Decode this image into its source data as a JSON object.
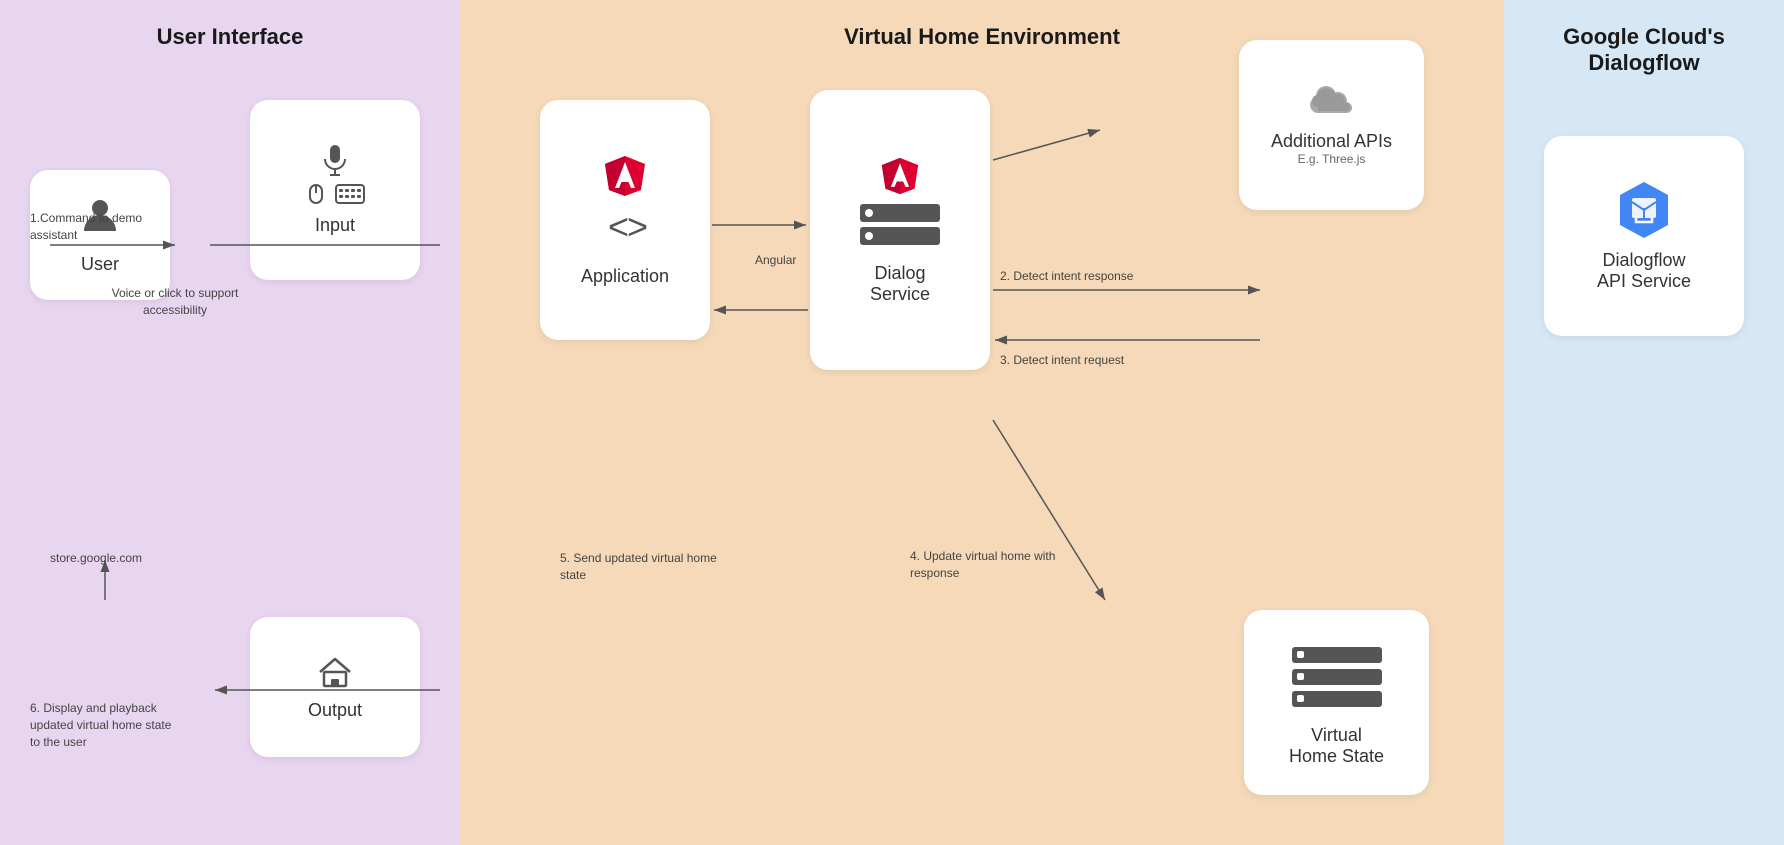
{
  "sections": {
    "user_interface": {
      "title": "User Interface",
      "user_card": {
        "label": "User"
      },
      "input_card": {
        "label": "Input"
      },
      "output_card": {
        "label": "Output"
      },
      "annotations": {
        "command": "1.Command to demo assistant",
        "voice": "Voice or click to support accessibility",
        "store": "store.google.com",
        "display": "6. Display and playback updated virtual home state to the user"
      }
    },
    "virtual_home": {
      "title": "Virtual Home Environment",
      "application_card": {
        "label": "Application"
      },
      "dialog_service_card": {
        "label": "Dialog\nService"
      },
      "additional_apis_card": {
        "label": "Additional APIs",
        "sublabel": "E.g. Three.js"
      },
      "virtual_home_state_card": {
        "label": "Virtual\nHome State"
      },
      "annotations": {
        "angular": "Angular",
        "step2": "2. Detect intent response",
        "step3": "3. Detect intent request",
        "step4": "4. Update virtual home\nwith response",
        "step5": "5. Send updated virtual\nhome state"
      }
    },
    "dialogflow": {
      "title": "Google Cloud's\nDialogflow",
      "card": {
        "label": "Dialogflow\nAPI Service"
      }
    }
  }
}
